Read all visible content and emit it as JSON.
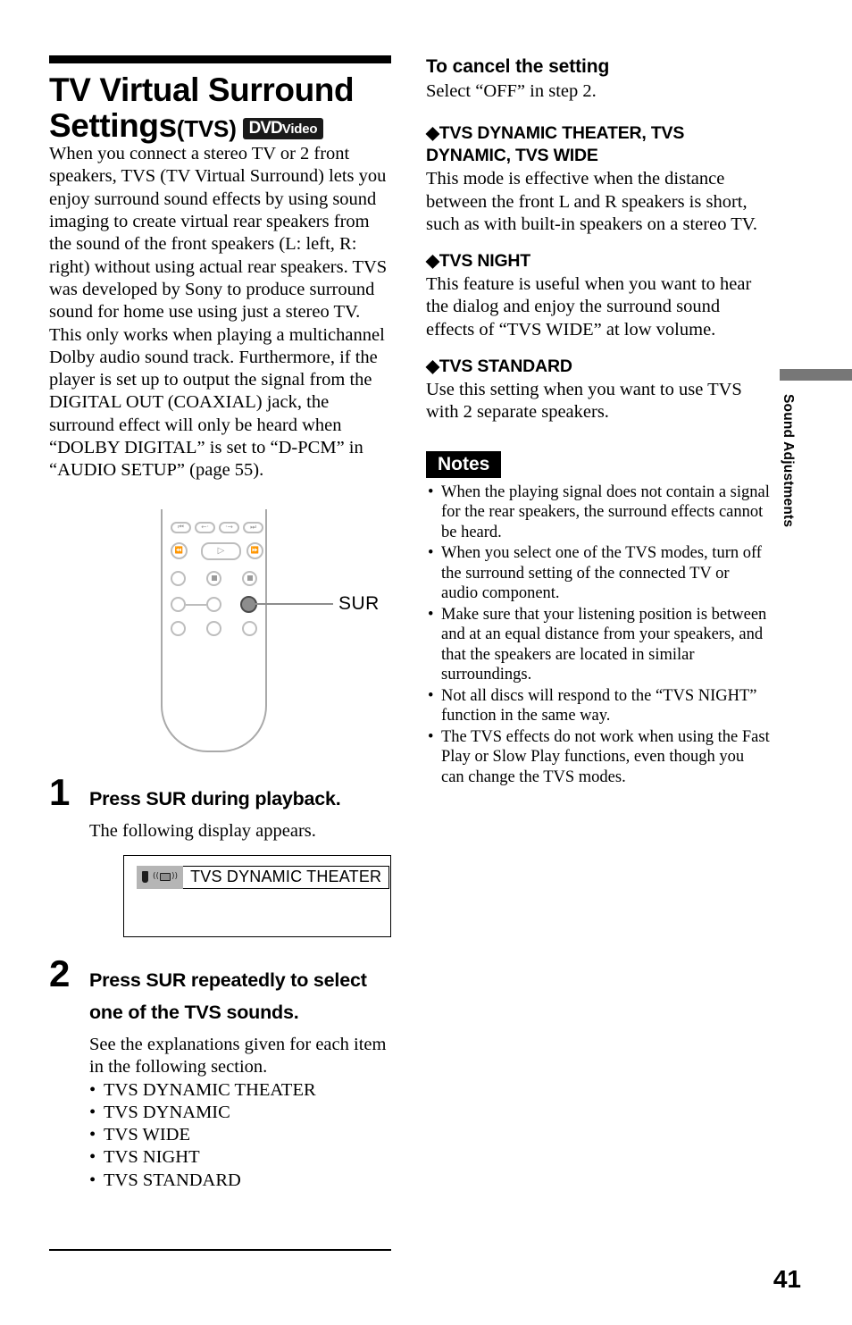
{
  "page": {
    "number": "41",
    "side_tab_label": "Sound Adjustments"
  },
  "left": {
    "title_line1": "TV Virtual Surround",
    "title_line2": "Settings",
    "title_suffix": "(TVS)",
    "badge": {
      "part1": "DVD",
      "part2": "Video"
    },
    "intro": "When you connect a stereo TV or 2 front speakers, TVS (TV Virtual Surround) lets you enjoy surround sound effects by using sound imaging to create virtual rear speakers from the sound of the front speakers (L: left, R: right) without using actual rear speakers. TVS was developed by Sony to produce surround sound for home use using just a stereo TV.",
    "intro2": "This only works when playing a multichannel Dolby audio sound track. Furthermore, if the player is set up to output the signal from the DIGITAL OUT (COAXIAL) jack, the surround effect will only be heard when “DOLBY DIGITAL” is set to “D-PCM” in “AUDIO SETUP” (page 55).",
    "remote": {
      "callout_label": "SUR"
    },
    "step1": {
      "number": "1",
      "heading": "Press SUR during playback.",
      "body": "The following display appears.",
      "osd_text": "TVS DYNAMIC THEATER"
    },
    "step2": {
      "number": "2",
      "heading_line1": "Press SUR repeatedly to select",
      "heading_line2": "one of the TVS sounds.",
      "body": "See the explanations given for each item in the following section.",
      "items": [
        "TVS DYNAMIC THEATER",
        "TVS DYNAMIC",
        "TVS WIDE",
        "TVS NIGHT",
        "TVS STANDARD"
      ]
    }
  },
  "right": {
    "cancel": {
      "heading": "To cancel the setting",
      "body": "Select “OFF” in step 2."
    },
    "sections": [
      {
        "heading": "◆TVS DYNAMIC THEATER, TVS DYNAMIC, TVS WIDE",
        "body": "This mode is effective when the distance between the front L and R speakers is short, such as with built-in speakers on a stereo TV."
      },
      {
        "heading": "◆TVS NIGHT",
        "body": "This feature is useful when you want to hear the dialog and enjoy the surround sound effects of “TVS WIDE” at low volume."
      },
      {
        "heading": "◆TVS STANDARD",
        "body": "Use this setting when you want to use TVS with 2 separate speakers."
      }
    ],
    "notes": {
      "label": "Notes",
      "items": [
        "When the playing signal does not contain a signal for the rear speakers, the surround effects cannot be heard.",
        "When you select one of the TVS modes, turn off the surround setting of the connected TV or audio component.",
        "Make sure that your listening position is between and at an equal distance from your speakers, and that the speakers are located in similar surroundings.",
        "Not all discs will respond to the “TVS NIGHT” function in the same way.",
        "The TVS effects do not work when using the Fast Play or Slow Play functions, even though you can change the TVS modes."
      ]
    }
  }
}
